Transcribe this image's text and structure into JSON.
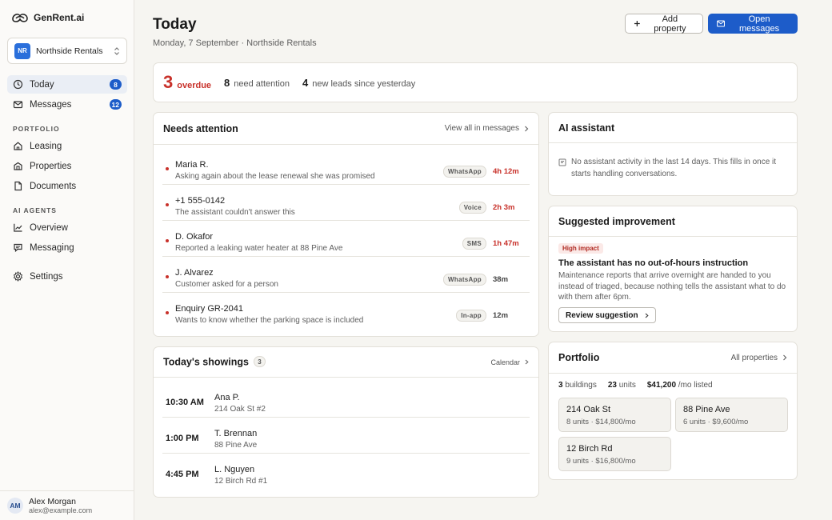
{
  "brand": {
    "name": "GenRent.ai"
  },
  "org": {
    "initials": "NR",
    "name": "Northside Rentals"
  },
  "nav": {
    "today": {
      "label": "Today",
      "count": "8"
    },
    "messages": {
      "label": "Messages",
      "count": "12"
    },
    "portfolio_section": "PORTFOLIO",
    "leasing": "Leasing",
    "properties": "Properties",
    "documents": "Documents",
    "ai_section": "AI AGENTS",
    "overview": "Overview",
    "messaging": "Messaging",
    "settings": "Settings"
  },
  "user": {
    "initials": "AM",
    "name": "Alex Morgan",
    "email": "alex@example.com"
  },
  "header": {
    "title": "Today",
    "subtitle": "Monday, 7 September · Northside Rentals",
    "add_property": "Add property",
    "open_messages": "Open messages"
  },
  "stats": {
    "overdue_num": "3",
    "overdue_label": "overdue",
    "attention_num": "8",
    "attention_label": "need attention",
    "leads_num": "4",
    "leads_label": "new leads since yesterday"
  },
  "needs_attention": {
    "title": "Needs attention",
    "link": "View all in messages",
    "items": [
      {
        "name": "Maria R.",
        "desc": "Asking again about the lease renewal she was promised",
        "channel": "WhatsApp",
        "time": "4h 12m"
      },
      {
        "name": "+1 555-0142",
        "desc": "The assistant couldn't answer this",
        "channel": "Voice",
        "time": "2h 3m"
      },
      {
        "name": "D. Okafor",
        "desc": "Reported a leaking water heater at 88 Pine Ave",
        "channel": "SMS",
        "time": "1h 47m"
      },
      {
        "name": "J. Alvarez",
        "desc": "Customer asked for a person",
        "channel": "WhatsApp",
        "time": "38m"
      },
      {
        "name": "Enquiry GR-2041",
        "desc": "Wants to know whether the parking space is included",
        "channel": "In-app",
        "time": "12m"
      }
    ]
  },
  "showings": {
    "title": "Today's showings",
    "count": "3",
    "link": "Calendar",
    "items": [
      {
        "time": "10:30 AM",
        "name": "Ana P.",
        "address": "214 Oak St #2"
      },
      {
        "time": "1:00 PM",
        "name": "T. Brennan",
        "address": "88 Pine Ave"
      },
      {
        "time": "4:45 PM",
        "name": "L. Nguyen",
        "address": "12 Birch Rd #1"
      }
    ]
  },
  "ai_assistant": {
    "title": "AI assistant",
    "body": "No assistant activity in the last 14 days. This fills in once it starts handling conversations."
  },
  "suggestion": {
    "title": "Suggested improvement",
    "impact": "High impact",
    "headline": "The assistant has no out-of-hours instruction",
    "desc": "Maintenance reports that arrive overnight are handed to you instead of triaged, because nothing tells the assistant what to do with them after 6pm.",
    "button": "Review suggestion"
  },
  "portfolio": {
    "title": "Portfolio",
    "link": "All properties",
    "buildings_num": "3",
    "buildings_label": "buildings",
    "units_num": "23",
    "units_label": "units",
    "listed_num": "$41,200",
    "listed_label": "/mo listed",
    "properties": [
      {
        "name": "214 Oak St",
        "meta": "8 units · $14,800/mo"
      },
      {
        "name": "88 Pine Ave",
        "meta": "6 units · $9,600/mo"
      },
      {
        "name": "12 Birch Rd",
        "meta": "9 units · $16,800/mo"
      }
    ]
  },
  "colors": {
    "accent": "#1d5cc9",
    "alert": "#c8312a"
  }
}
